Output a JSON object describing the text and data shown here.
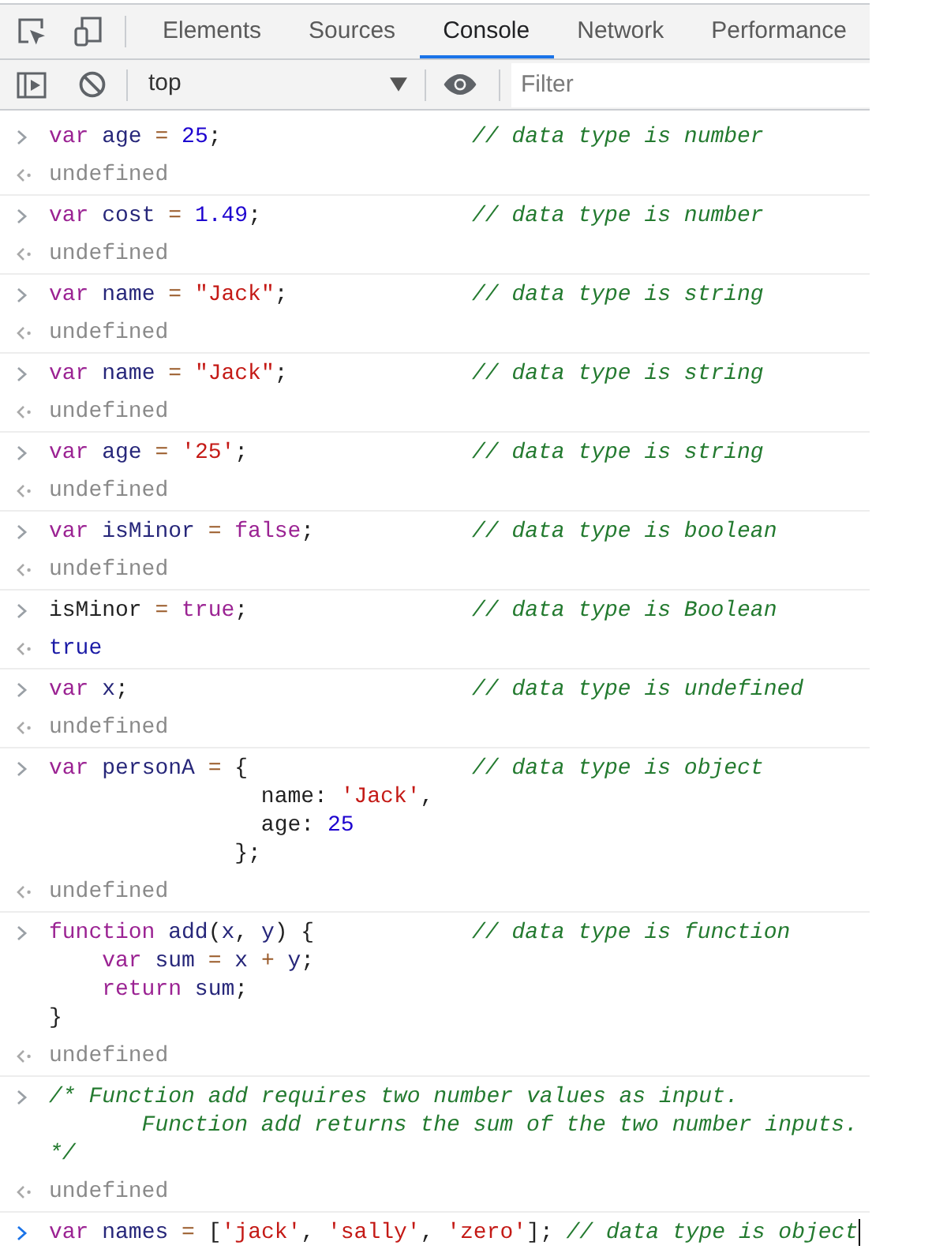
{
  "toolbar": {
    "tabs": [
      {
        "label": "Elements",
        "selected": false
      },
      {
        "label": "Sources",
        "selected": false
      },
      {
        "label": "Console",
        "selected": true
      },
      {
        "label": "Network",
        "selected": false
      },
      {
        "label": "Performance",
        "selected": false
      }
    ]
  },
  "console_toolbar": {
    "context": "top",
    "filter": {
      "placeholder": "Filter"
    }
  },
  "console": {
    "entries": [
      {
        "input": {
          "lines": [
            [
              {
                "kind": "keyword",
                "text": "var"
              },
              {
                "kind": "variable",
                "text": " age"
              },
              {
                "kind": "operator",
                "text": " = "
              },
              {
                "kind": "number",
                "text": "25"
              },
              {
                "kind": "plain",
                "text": ";"
              }
            ]
          ],
          "comment": "// data type is number"
        },
        "result": {
          "kind": "undefined",
          "text": "undefined"
        }
      },
      {
        "input": {
          "lines": [
            [
              {
                "kind": "keyword",
                "text": "var"
              },
              {
                "kind": "variable",
                "text": " cost"
              },
              {
                "kind": "operator",
                "text": " = "
              },
              {
                "kind": "number",
                "text": "1.49"
              },
              {
                "kind": "plain",
                "text": ";"
              }
            ]
          ],
          "comment": "// data type is number"
        },
        "result": {
          "kind": "undefined",
          "text": "undefined"
        }
      },
      {
        "input": {
          "lines": [
            [
              {
                "kind": "keyword",
                "text": "var"
              },
              {
                "kind": "variable",
                "text": " name"
              },
              {
                "kind": "operator",
                "text": " = "
              },
              {
                "kind": "string",
                "text": "\"Jack\""
              },
              {
                "kind": "plain",
                "text": ";"
              }
            ]
          ],
          "comment": "// data type is string"
        },
        "result": {
          "kind": "undefined",
          "text": "undefined"
        }
      },
      {
        "input": {
          "lines": [
            [
              {
                "kind": "keyword",
                "text": "var"
              },
              {
                "kind": "variable",
                "text": " name"
              },
              {
                "kind": "operator",
                "text": " = "
              },
              {
                "kind": "string",
                "text": "\"Jack\""
              },
              {
                "kind": "plain",
                "text": ";"
              }
            ]
          ],
          "comment": "// data type is string"
        },
        "result": {
          "kind": "undefined",
          "text": "undefined"
        }
      },
      {
        "input": {
          "lines": [
            [
              {
                "kind": "keyword",
                "text": "var"
              },
              {
                "kind": "variable",
                "text": " age"
              },
              {
                "kind": "operator",
                "text": " = "
              },
              {
                "kind": "string",
                "text": "'25'"
              },
              {
                "kind": "plain",
                "text": ";"
              }
            ]
          ],
          "comment": "// data type is string"
        },
        "result": {
          "kind": "undefined",
          "text": "undefined"
        }
      },
      {
        "input": {
          "lines": [
            [
              {
                "kind": "keyword",
                "text": "var"
              },
              {
                "kind": "variable",
                "text": " isMinor"
              },
              {
                "kind": "operator",
                "text": " = "
              },
              {
                "kind": "keyword",
                "text": "false"
              },
              {
                "kind": "plain",
                "text": ";"
              }
            ]
          ],
          "comment": "// data type is boolean"
        },
        "result": {
          "kind": "undefined",
          "text": "undefined"
        }
      },
      {
        "input": {
          "lines": [
            [
              {
                "kind": "plain",
                "text": "isMinor"
              },
              {
                "kind": "operator",
                "text": " = "
              },
              {
                "kind": "keyword",
                "text": "true"
              },
              {
                "kind": "plain",
                "text": ";"
              }
            ]
          ],
          "comment": "// data type is Boolean"
        },
        "result": {
          "kind": "boolean",
          "text": "true"
        }
      },
      {
        "input": {
          "lines": [
            [
              {
                "kind": "keyword",
                "text": "var"
              },
              {
                "kind": "variable",
                "text": " x"
              },
              {
                "kind": "plain",
                "text": ";"
              }
            ]
          ],
          "comment": "// data type is undefined"
        },
        "result": {
          "kind": "undefined",
          "text": "undefined"
        }
      },
      {
        "input": {
          "lines": [
            [
              {
                "kind": "keyword",
                "text": "var"
              },
              {
                "kind": "variable",
                "text": " personA"
              },
              {
                "kind": "operator",
                "text": " = "
              },
              {
                "kind": "plain",
                "text": "{"
              }
            ],
            [
              {
                "kind": "plain",
                "text": "                name: "
              },
              {
                "kind": "string",
                "text": "'Jack'"
              },
              {
                "kind": "plain",
                "text": ","
              }
            ],
            [
              {
                "kind": "plain",
                "text": "                age: "
              },
              {
                "kind": "number",
                "text": "25"
              }
            ],
            [
              {
                "kind": "plain",
                "text": "              };"
              }
            ]
          ],
          "comment": "// data type is object"
        },
        "result": {
          "kind": "undefined",
          "text": "undefined"
        }
      },
      {
        "input": {
          "lines": [
            [
              {
                "kind": "keyword",
                "text": "function"
              },
              {
                "kind": "variable",
                "text": " add"
              },
              {
                "kind": "plain",
                "text": "("
              },
              {
                "kind": "variable",
                "text": "x"
              },
              {
                "kind": "plain",
                "text": ", "
              },
              {
                "kind": "variable",
                "text": "y"
              },
              {
                "kind": "plain",
                "text": ") {"
              }
            ],
            [
              {
                "kind": "keyword",
                "text": "    var"
              },
              {
                "kind": "variable",
                "text": " sum"
              },
              {
                "kind": "operator",
                "text": " = "
              },
              {
                "kind": "variable",
                "text": "x"
              },
              {
                "kind": "operator",
                "text": " + "
              },
              {
                "kind": "variable",
                "text": "y"
              },
              {
                "kind": "plain",
                "text": ";"
              }
            ],
            [
              {
                "kind": "keyword",
                "text": "    return"
              },
              {
                "kind": "variable",
                "text": " sum"
              },
              {
                "kind": "plain",
                "text": ";"
              }
            ],
            [
              {
                "kind": "plain",
                "text": "}"
              }
            ]
          ],
          "comment": "// data type is function"
        },
        "result": {
          "kind": "undefined",
          "text": "undefined"
        }
      },
      {
        "input": {
          "lines": [
            [
              {
                "kind": "comment",
                "text": "/* Function add requires two number values as input."
              }
            ],
            [
              {
                "kind": "comment",
                "text": "       Function add returns the sum of the two number inputs."
              }
            ],
            [
              {
                "kind": "comment",
                "text": "*/"
              }
            ]
          ]
        },
        "result": {
          "kind": "undefined",
          "text": "undefined"
        }
      }
    ],
    "prompt": {
      "tokens": [
        {
          "kind": "keyword",
          "text": "var"
        },
        {
          "kind": "variable",
          "text": " names"
        },
        {
          "kind": "operator",
          "text": " = "
        },
        {
          "kind": "plain",
          "text": "["
        },
        {
          "kind": "string",
          "text": "'jack'"
        },
        {
          "kind": "plain",
          "text": ", "
        },
        {
          "kind": "string",
          "text": "'sally'"
        },
        {
          "kind": "plain",
          "text": ", "
        },
        {
          "kind": "string",
          "text": "'zero'"
        },
        {
          "kind": "plain",
          "text": "];"
        },
        {
          "kind": "comment",
          "text": " // data type is object"
        }
      ]
    }
  }
}
